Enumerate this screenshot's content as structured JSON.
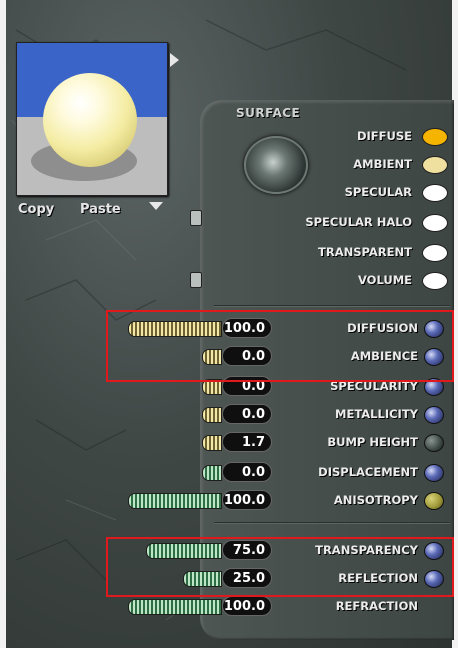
{
  "preview": {
    "copy_label": "Copy",
    "paste_label": "Paste"
  },
  "surface": {
    "title": "SURFACE",
    "channels": [
      {
        "label": "DIFFUSE",
        "color": "#f5b400"
      },
      {
        "label": "AMBIENT",
        "color": "#efe0a0"
      },
      {
        "label": "SPECULAR",
        "color": "#ffffff"
      },
      {
        "label": "SPECULAR HALO",
        "color": "#ffffff"
      },
      {
        "label": "TRANSPARENT",
        "color": "#ffffff"
      },
      {
        "label": "VOLUME",
        "color": "#ffffff"
      }
    ]
  },
  "parameters": [
    {
      "label": "DIFFUSION",
      "value": "100.0",
      "level": 1.0,
      "bar": "gold",
      "knob": "blue"
    },
    {
      "label": "AMBIENCE",
      "value": "0.0",
      "level": 0.0,
      "bar": "gold",
      "knob": "blue"
    },
    {
      "label": "SPECULARITY",
      "value": "0.0",
      "level": 0.0,
      "bar": "gold",
      "knob": "blue"
    },
    {
      "label": "METALLICITY",
      "value": "0.0",
      "level": 0.0,
      "bar": "gold",
      "knob": "blue"
    },
    {
      "label": "BUMP HEIGHT",
      "value": "1.7",
      "level": 0.0,
      "bar": "gold",
      "knob": "dark"
    },
    {
      "label": "DISPLACEMENT",
      "value": "0.0",
      "level": 0.0,
      "bar": "green",
      "knob": "blue"
    },
    {
      "label": "ANISOTROPY",
      "value": "100.0",
      "level": 1.0,
      "bar": "green",
      "knob": "olive"
    },
    {
      "label": "TRANSPARENCY",
      "value": "75.0",
      "level": 0.75,
      "bar": "green",
      "knob": "blue"
    },
    {
      "label": "REFLECTION",
      "value": "25.0",
      "level": 0.25,
      "bar": "green",
      "knob": "blue"
    },
    {
      "label": "REFRACTION",
      "value": "100.0",
      "level": 1.0,
      "bar": "green",
      "knob": "none"
    }
  ]
}
